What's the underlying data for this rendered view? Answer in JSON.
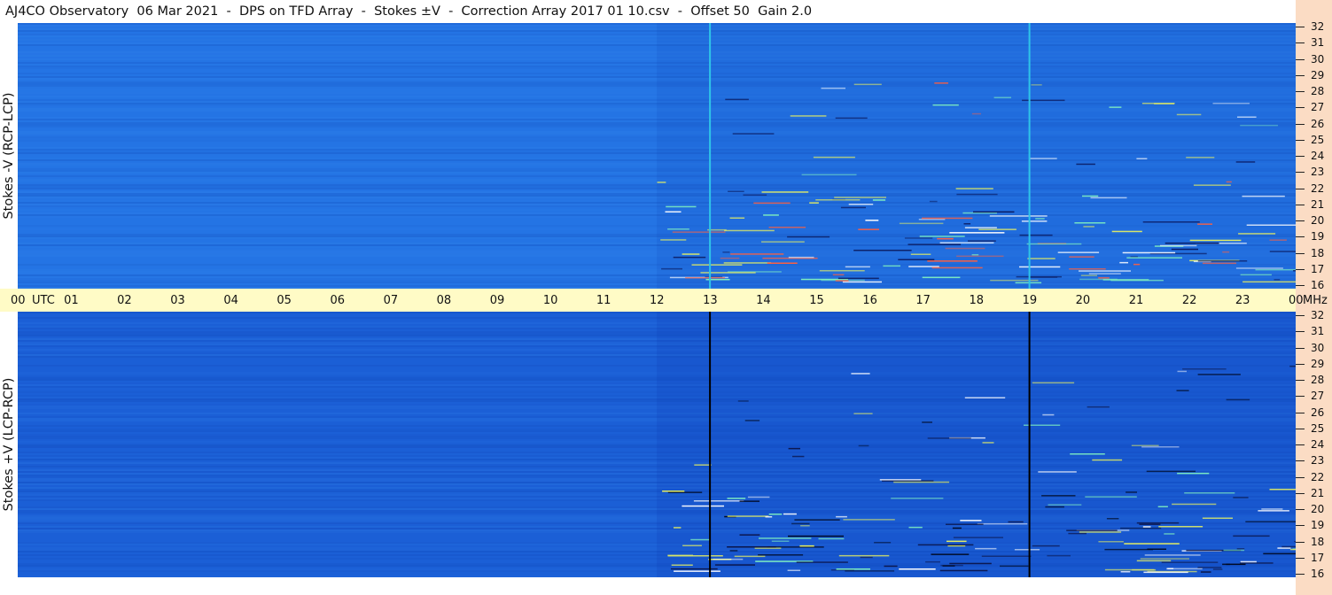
{
  "title": "AJ4CO Observatory  06 Mar 2021  -  DPS on TFD Array  -  Stokes ±V  -  Correction Array 2017 01 10.csv  -  Offset 50  Gain 2.0",
  "panels": {
    "top": {
      "label": "Stokes -V (RCP-LCP)",
      "bg": "#2474e4",
      "marker_color": "#2ec4e8"
    },
    "bottom": {
      "label": "Stokes +V (LCP-RCP)",
      "bg": "#1b5fd6",
      "marker_color": "#000000"
    }
  },
  "time_axis": {
    "labels": [
      "00",
      "01",
      "02",
      "03",
      "04",
      "05",
      "06",
      "07",
      "08",
      "09",
      "10",
      "11",
      "12",
      "13",
      "14",
      "15",
      "16",
      "17",
      "18",
      "19",
      "20",
      "21",
      "22",
      "23",
      "00"
    ],
    "unit_label": "UTC",
    "freq_unit": "MHz",
    "marker_hours": [
      13,
      19
    ]
  },
  "freq_axis": {
    "labels": [
      "32",
      "31",
      "30",
      "29",
      "28",
      "27",
      "26",
      "25",
      "24",
      "23",
      "22",
      "21",
      "20",
      "19",
      "18",
      "17",
      "16"
    ]
  }
}
